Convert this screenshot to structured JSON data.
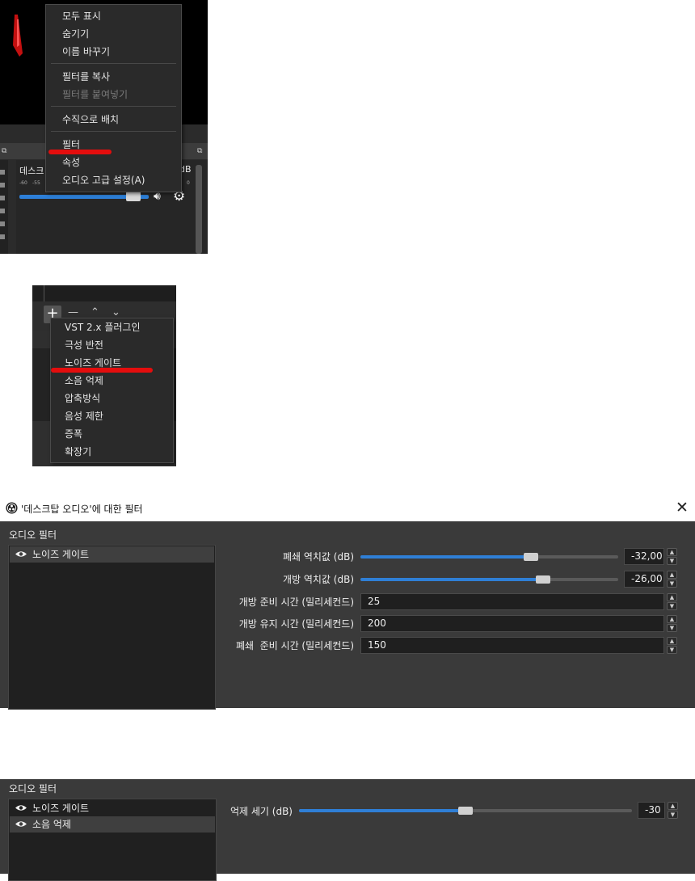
{
  "context_menu": {
    "items": [
      {
        "label": "모두 표시",
        "disabled": false
      },
      {
        "label": "숨기기",
        "disabled": false
      },
      {
        "label": "이름 바꾸기",
        "disabled": false
      },
      {
        "label": "필터를 복사",
        "disabled": false
      },
      {
        "label": "필터를 붙여넣기",
        "disabled": true
      },
      {
        "label": "수직으로 배치",
        "disabled": false
      },
      {
        "label": "필터",
        "disabled": false,
        "highlighted": true
      },
      {
        "label": "속성",
        "disabled": false
      },
      {
        "label": "오디오 고급 설정(A)",
        "disabled": false
      }
    ]
  },
  "mixer": {
    "source_label": "데스크",
    "db_label": "dB",
    "meter_ticks": [
      "-60",
      "-55"
    ],
    "meter_end": "0",
    "volume_fraction": 0.88
  },
  "filter_add_menu": {
    "items": [
      {
        "label": "VST 2.x 플러그인"
      },
      {
        "label": "극성 반전"
      },
      {
        "label": "노이즈 게이트",
        "highlighted": true
      },
      {
        "label": "소음 억제"
      },
      {
        "label": "압축방식"
      },
      {
        "label": "음성 제한"
      },
      {
        "label": "증폭"
      },
      {
        "label": "확장기"
      }
    ]
  },
  "filter_dialog": {
    "title": "'데스크탑 오디오'에 대한 필터",
    "close": "✕",
    "section_label": "오디오 필터",
    "filters": [
      "노이즈 게이트"
    ],
    "properties": [
      {
        "label": "폐쇄 역치값 (dB)",
        "value": "-32,00",
        "slider_fraction": 0.66
      },
      {
        "label": "개방 역치값 (dB)",
        "value": "-26,00",
        "slider_fraction": 0.71
      },
      {
        "label": "개방 준비 시간 (밀리세컨드)",
        "value": "25"
      },
      {
        "label": "개방 유지 시간 (밀리세컨드)",
        "value": "200"
      },
      {
        "label": "폐쇄  준비 시간 (밀리세컨드)",
        "value": "150"
      }
    ]
  },
  "filter_dialog_2": {
    "section_label": "오디오 필터",
    "filters": [
      "노이즈 게이트",
      "소음 억제"
    ],
    "property": {
      "label": "억제 세기 (dB)",
      "value": "-30",
      "slider_fraction": 0.5
    }
  },
  "colors": {
    "accent": "#2f7fd6",
    "highlight_mark": "#e40d0d"
  }
}
